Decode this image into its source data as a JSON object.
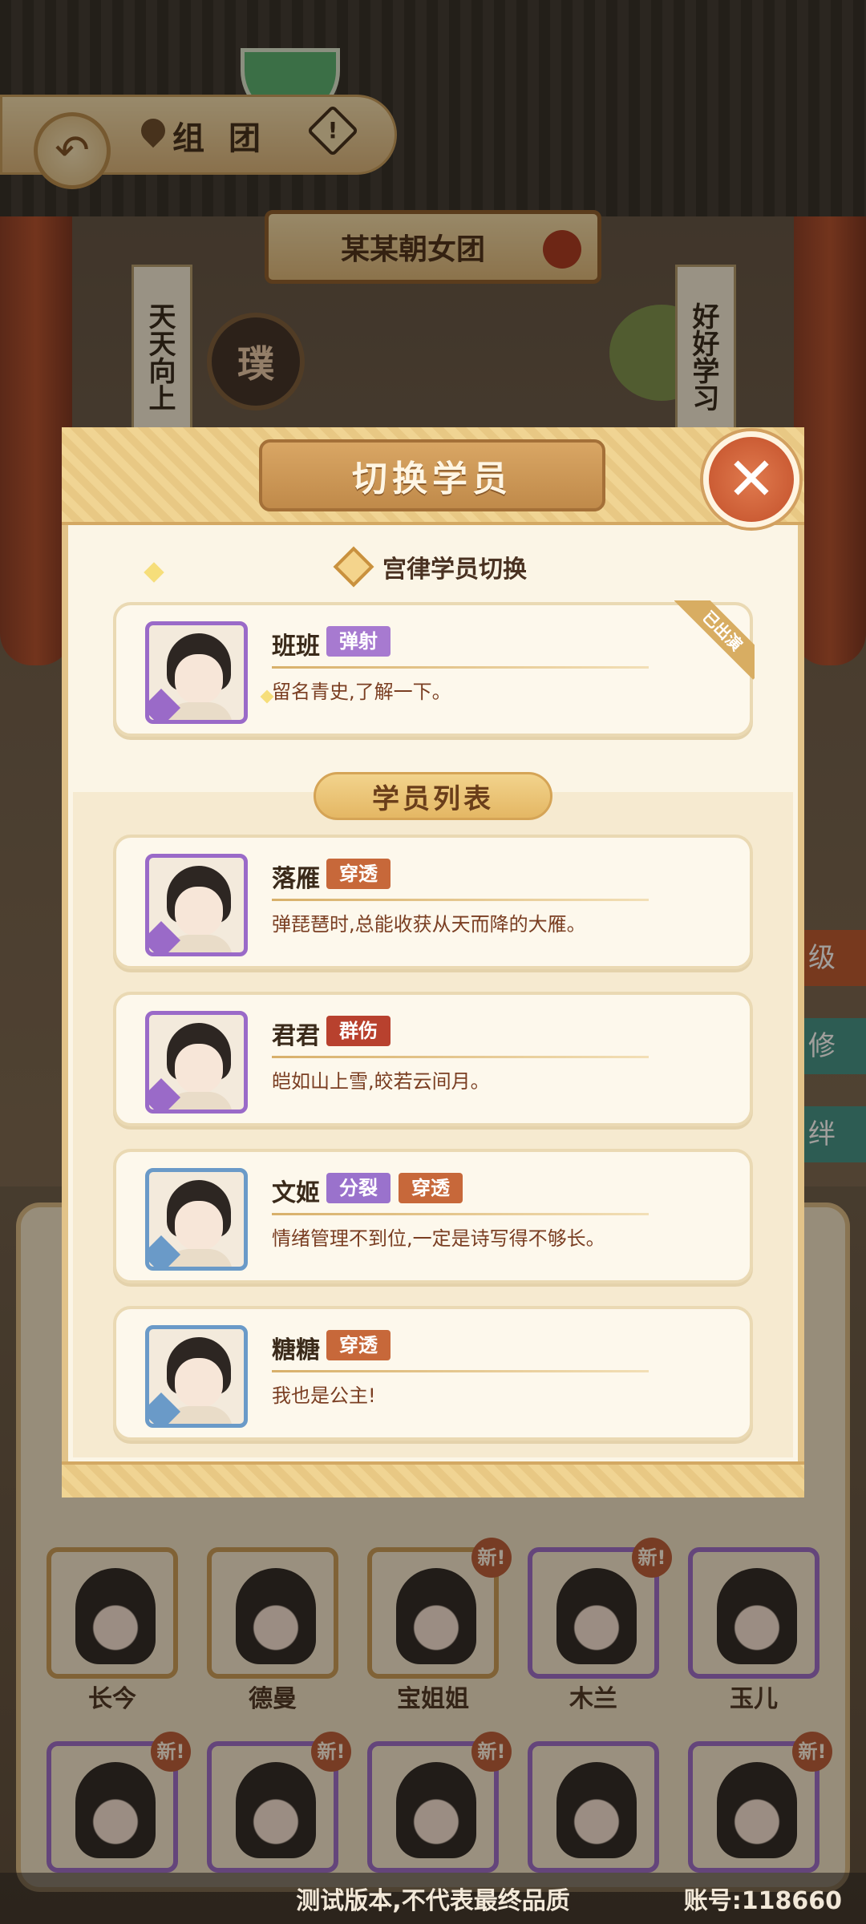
{
  "topbar": {
    "title": "组团",
    "warning_symbol": "!"
  },
  "group": {
    "name": "某某朝女团"
  },
  "scene": {
    "banner_left": "天天向上",
    "banner_right": "好好学习",
    "seal_char": "璞"
  },
  "modal": {
    "title": "切换学员",
    "close_symbol": "✕",
    "current_section_label": "宫律学员切换",
    "list_title": "学员列表",
    "current": {
      "name": "班班",
      "tags": [
        {
          "label": "弹射",
          "color": "#a77ad0"
        }
      ],
      "desc": "留名青史,了解一下。",
      "ribbon": "已出演"
    },
    "students": [
      {
        "name": "落雁",
        "tags": [
          {
            "label": "穿透",
            "color": "#c7683a"
          }
        ],
        "desc": "弹琵琶时,总能收获从天而降的大雁。",
        "frame": "purple"
      },
      {
        "name": "君君",
        "tags": [
          {
            "label": "群伤",
            "color": "#b8412e"
          }
        ],
        "desc": "皑如山上雪,皎若云间月。",
        "frame": "purple"
      },
      {
        "name": "文姬",
        "tags": [
          {
            "label": "分裂",
            "color": "#9a72cc"
          },
          {
            "label": "穿透",
            "color": "#c7683a"
          }
        ],
        "desc": "情绪管理不到位,一定是诗写得不够长。",
        "frame": "blue"
      },
      {
        "name": "糖糖",
        "tags": [
          {
            "label": "穿透",
            "color": "#c7683a"
          }
        ],
        "desc": "我也是公主!",
        "frame": "blue"
      }
    ]
  },
  "grid": {
    "row1": [
      {
        "name": "长今",
        "new": false,
        "frame": "gold"
      },
      {
        "name": "德曼",
        "new": false,
        "frame": "gold"
      },
      {
        "name": "宝姐姐",
        "new": true,
        "frame": "gold"
      },
      {
        "name": "木兰",
        "new": true,
        "frame": "purple"
      },
      {
        "name": "玉儿",
        "new": false,
        "frame": "purple"
      }
    ],
    "new_label": "新!"
  },
  "side_tabs": [
    "级",
    "修",
    "绊"
  ],
  "footer": {
    "notice": "测试版本,不代表最终品质",
    "account": "账号:118660"
  }
}
